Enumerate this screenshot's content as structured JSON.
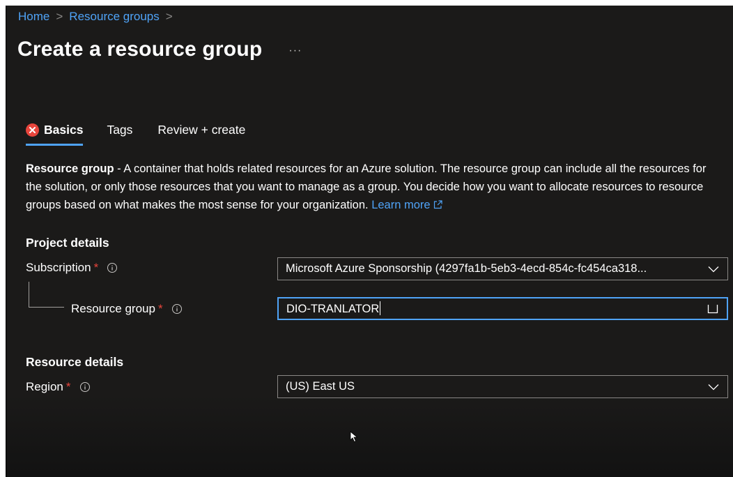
{
  "breadcrumb": {
    "items": [
      "Home",
      "Resource groups"
    ]
  },
  "page": {
    "title": "Create a resource group",
    "more_label": "···"
  },
  "tabs": [
    {
      "label": "Basics",
      "active": true,
      "has_error": true
    },
    {
      "label": "Tags",
      "active": false
    },
    {
      "label": "Review + create",
      "active": false
    }
  ],
  "description": {
    "strong": "Resource group",
    "text": " - A container that holds related resources for an Azure solution. The resource group can include all the resources for the solution, or only those resources that you want to manage as a group. You decide how you want to allocate resources to resource groups based on what makes the most sense for your organization. ",
    "learn_more": "Learn more"
  },
  "project_details": {
    "heading": "Project details",
    "subscription": {
      "label": "Subscription",
      "required": "*",
      "value": "Microsoft Azure Sponsorship (4297fa1b-5eb3-4ecd-854c-fc454ca318..."
    },
    "resource_group": {
      "label": "Resource group",
      "required": "*",
      "value": "DIO-TRANLATOR"
    }
  },
  "resource_details": {
    "heading": "Resource details",
    "region": {
      "label": "Region",
      "required": "*",
      "value": "(US) East US"
    }
  },
  "colors": {
    "accent": "#4fa3f7",
    "error": "#e8453c",
    "background": "#1b1a19"
  },
  "icons": {
    "tab_error": "error-circle-icon",
    "info": "info-icon",
    "dropdown": "chevron-down-icon",
    "external": "external-link-icon"
  }
}
